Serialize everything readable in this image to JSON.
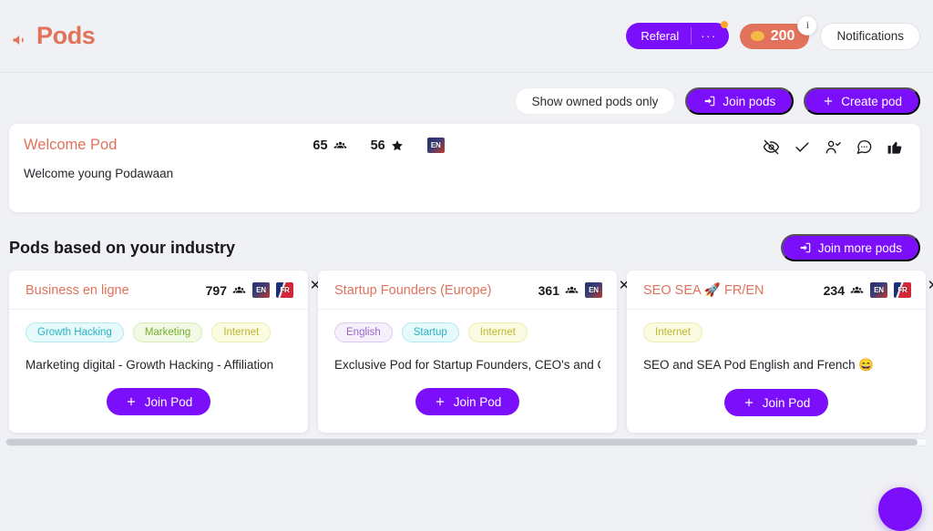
{
  "header": {
    "title": "Pods",
    "megaphone_icon": "megaphone-icon",
    "referal": {
      "label": "Referal",
      "more_label": "···"
    },
    "coins": {
      "value": "200",
      "info_label": "i",
      "coin_icon": "coin-icon"
    },
    "notifications_label": "Notifications"
  },
  "toolbar": {
    "show_owned_label": "Show owned pods only",
    "join_pods_label": "Join pods",
    "create_pod_label": "Create pod"
  },
  "welcome_pod": {
    "title": "Welcome Pod",
    "members": "65",
    "stars": "56",
    "language": "EN",
    "description": "Welcome young Podawaan",
    "actions": [
      {
        "name": "hide-icon"
      },
      {
        "name": "check-icon"
      },
      {
        "name": "user-check-icon"
      },
      {
        "name": "comment-icon"
      },
      {
        "name": "thumbs-up-icon"
      }
    ]
  },
  "section": {
    "title": "Pods based on your industry",
    "join_more_label": "Join more pods"
  },
  "pods": [
    {
      "name": "Business en ligne",
      "members": "797",
      "languages": [
        "EN",
        "FR"
      ],
      "tags": [
        {
          "label": "Growth Hacking",
          "color": "cyan"
        },
        {
          "label": "Marketing",
          "color": "green"
        },
        {
          "label": "Internet",
          "color": "yellow"
        }
      ],
      "description": "Marketing digital - Growth Hacking - Affiliation",
      "join_label": "Join Pod",
      "close_label": "✕"
    },
    {
      "name": "Startup Founders (Europe)",
      "members": "361",
      "languages": [
        "EN"
      ],
      "tags": [
        {
          "label": "English",
          "color": "purple"
        },
        {
          "label": "Startup",
          "color": "cyan"
        },
        {
          "label": "Internet",
          "color": "yellow"
        }
      ],
      "description": "Exclusive Pod for Startup Founders, CEO's and C-Le",
      "join_label": "Join Pod",
      "close_label": "✕"
    },
    {
      "name": "SEO SEA 🚀 FR/EN",
      "members": "234",
      "languages": [
        "EN",
        "FR"
      ],
      "tags": [
        {
          "label": "Internet",
          "color": "yellow"
        }
      ],
      "description": "SEO and SEA Pod English and French 😄",
      "join_label": "Join Pod",
      "close_label": "✕"
    }
  ],
  "colors": {
    "accent_purple": "#7c0ffb",
    "accent_coral": "#e2725b",
    "background": "#f0f1f5"
  }
}
